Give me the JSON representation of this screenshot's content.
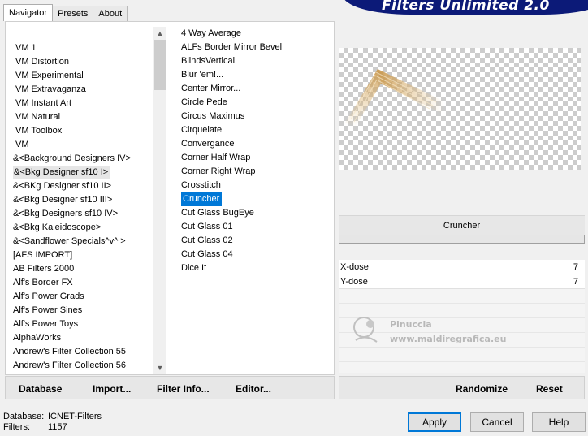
{
  "tabs": [
    {
      "label": "Navigator",
      "active": true
    },
    {
      "label": "Presets",
      "active": false
    },
    {
      "label": "About",
      "active": false
    }
  ],
  "banner": {
    "title": "Filters Unlimited 2.0"
  },
  "categories": [
    "VM 1",
    "VM Distortion",
    "VM Experimental",
    "VM Extravaganza",
    "VM Instant Art",
    "VM Natural",
    "VM Toolbox",
    "VM",
    "&<Background Designers IV>",
    "&<Bkg Designer sf10 I>",
    "&<BKg Designer sf10 II>",
    "&<Bkg Designer sf10 III>",
    "&<Bkg Designers sf10 IV>",
    "&<Bkg Kaleidoscope>",
    "&<Sandflower Specials^v^ >",
    "[AFS IMPORT]",
    "AB Filters 2000",
    "Alf's Border FX",
    "Alf's Power Grads",
    "Alf's Power Sines",
    "Alf's Power Toys",
    "AlphaWorks",
    "Andrew's Filter Collection 55",
    "Andrew's Filter Collection 56"
  ],
  "selected_category": "&<Bkg Designer sf10 I>",
  "filters": [
    "4 Way Average",
    "ALFs Border Mirror Bevel",
    "BlindsVertical",
    "Blur 'em!...",
    "Center Mirror...",
    "Circle Pede",
    "Circus Maximus",
    "Cirquelate",
    "Convergance",
    "Corner Half Wrap",
    "Corner Right Wrap",
    "Crosstitch",
    "Cruncher",
    "Cut Glass  BugEye",
    "Cut Glass 01",
    "Cut Glass 02",
    "Cut Glass 04",
    "Dice It"
  ],
  "selected_filter": "Cruncher",
  "left_buttons": {
    "database": "Database",
    "import": "Import...",
    "filter_info": "Filter Info...",
    "editor": "Editor..."
  },
  "right_buttons": {
    "randomize": "Randomize",
    "reset": "Reset"
  },
  "filter_name": "Cruncher",
  "params": [
    {
      "label": "X-dose",
      "value": "7"
    },
    {
      "label": "Y-dose",
      "value": "7"
    }
  ],
  "watermark": {
    "line1": "Pinuccia",
    "line2": "www.maldiregrafica.eu"
  },
  "status": {
    "database_label": "Database:",
    "database_value": "ICNET-Filters",
    "filters_label": "Filters:",
    "filters_value": "1157"
  },
  "dialog_buttons": {
    "apply": "Apply",
    "cancel": "Cancel",
    "help": "Help"
  },
  "colors": {
    "selection": "#0078d7",
    "banner": "#0c1a78",
    "preview_shape": "#c8964a"
  }
}
